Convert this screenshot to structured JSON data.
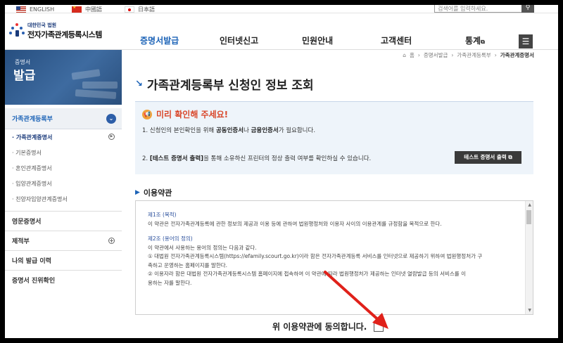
{
  "top_bar": {
    "languages": [
      "ENGLISH",
      "中國語",
      "日本語"
    ],
    "search_placeholder": "검색어를 입력하세요.",
    "search_icon": "search-icon"
  },
  "header": {
    "logo_sub": "대한민국 법원",
    "logo_main": "전자가족관계등록시스템",
    "nav": [
      "증명서발급",
      "인터넷신고",
      "민원안내",
      "고객센터",
      "통계"
    ],
    "active_nav": "증명서발급",
    "menu_icon": "hamburger-icon"
  },
  "sidebar": {
    "banner_t1": "증명서",
    "banner_t2": "발급",
    "section_title": "가족관계등록부",
    "sub_items": [
      "가족관계증명서",
      "기본증명서",
      "혼인관계증명서",
      "입양관계증명서",
      "친양자입양관계증명서"
    ],
    "active_sub": "가족관계증명서",
    "items": [
      "영문증명서",
      "제적부",
      "나의 발급 이력",
      "증명서 진위확인"
    ]
  },
  "breadcrumb": [
    "홈",
    "증명서발급",
    "가족관계등록부",
    "가족관계증명서"
  ],
  "main": {
    "title": "가족관계등록부 신청인 정보 조회",
    "notice": {
      "title": "미리 확인해 주세요!",
      "line1_a": "1. 신청인의 본인확인을 위해 ",
      "line1_b": "공동인증서",
      "line1_c": "나 ",
      "line1_d": "금융인증서",
      "line1_e": "가 필요합니다.",
      "line2_a": "2. ",
      "line2_b": "[테스트 증명서 출력]",
      "line2_c": "을 통해 소유하신 프린터의 정상 출력 여부를 확인하실 수 있습니다.",
      "test_button": "테스트 증명서 출력"
    },
    "terms_heading": "이용약관",
    "terms": {
      "art1_title": "제1조 (목적)",
      "art1_body": "이 약관은 전자가족관계등록에 관한 정보의 제공과 이용 등에 관하여 법원행정처와 이용자 사이의 이용관계를 규정함을 목적으로 한다.",
      "art2_title": "제2조 (용어의 정의)",
      "art2_intro": "이 약관에서 사용하는 용어의 정의는 다음과 같다.",
      "art2_1a": "① 대법원 전자가족관계등록시스템(https://efamily.scourt.go.kr)이라 함은 전자가족관계등록 서비스를 인터넷으로 제공하기 위하여 법원행정처가 구",
      "art2_1b": "축하고 운영하는 홈페이지를 말한다.",
      "art2_2a": "② 이용자라 함은 대법원 전자가족관계등록시스템 홈페이지에 접속하여 이 약관에 따라 법원행정처가 제공하는 인터넷 열람발급 등의 서비스를 이",
      "art2_2b": "용하는 자를 말한다."
    },
    "agree_label": "위 이용약관에 동의합니다."
  }
}
